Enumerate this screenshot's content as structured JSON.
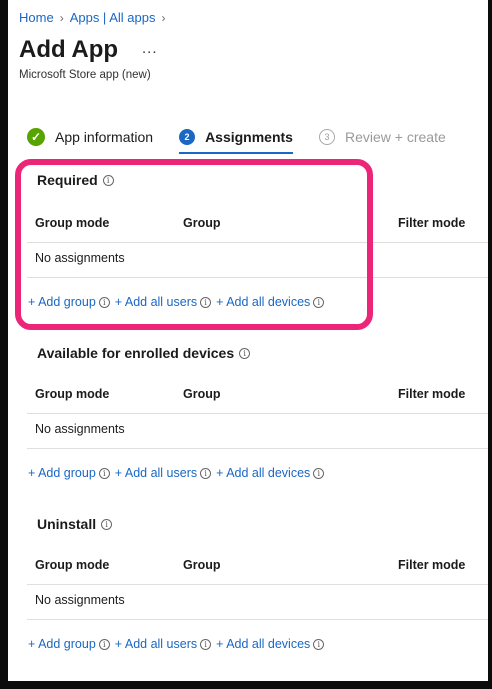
{
  "breadcrumb": {
    "home": "Home",
    "apps": "Apps | All apps"
  },
  "header": {
    "title": "Add App",
    "more": "...",
    "subtitle": "Microsoft Store app (new)"
  },
  "steps": [
    {
      "number": "✓",
      "label": "App information",
      "state": "done"
    },
    {
      "number": "2",
      "label": "Assignments",
      "state": "active"
    },
    {
      "number": "3",
      "label": "Review + create",
      "state": "pending"
    }
  ],
  "columns": {
    "group_mode": "Group mode",
    "group": "Group",
    "filter_mode": "Filter mode"
  },
  "empty_text": "No assignments",
  "links": {
    "add_group": "+ Add group",
    "add_all_users": "+ Add all users",
    "add_all_devices": "+ Add all devices"
  },
  "sections": {
    "required": {
      "title": "Required"
    },
    "available": {
      "title": "Available for enrolled devices"
    },
    "uninstall": {
      "title": "Uninstall"
    }
  },
  "colors": {
    "accent": "#1a67c4",
    "highlight": "#ec2578",
    "success": "#57a300"
  },
  "icons": {
    "info": "i",
    "chevron": "›"
  }
}
